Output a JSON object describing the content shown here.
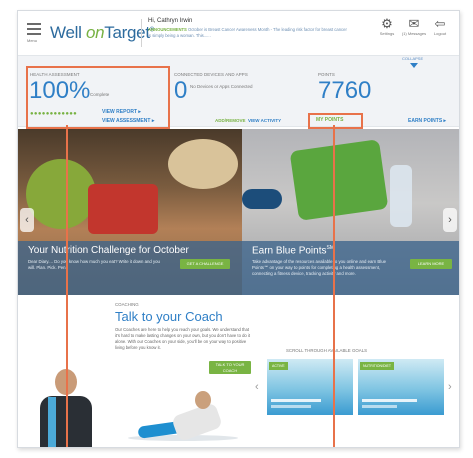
{
  "header": {
    "menu_label": "Menu",
    "logo_prefix": "Well ",
    "logo_on": "on",
    "logo_suffix": "Target",
    "logo_mark": "®",
    "greeting": "Hi, Cathryn Irwin",
    "announcement_label": "ANNOUNCEMENTS",
    "announcement_text": "October is Breast Cancer Awareness Month - The leading risk factor for breast cancer is simply being a woman. This......",
    "settings_label": "Settings",
    "messages_label": "(1) Messages",
    "logout_label": "Logout",
    "settings_icon": "gear-icon",
    "messages_icon": "envelope-icon",
    "logout_icon": "logout-icon"
  },
  "stats": {
    "collapse_label": "COLLAPSE",
    "health": {
      "label": "HEALTH ASSESSMENT",
      "percent": "100%",
      "status": "Complete",
      "view_report": "VIEW REPORT ▸",
      "view_assessment": "VIEW ASSESSMENT ▸",
      "progress_dots": "●●●●●●●●●●●●"
    },
    "devices": {
      "label": "CONNECTED DEVICES AND APPS",
      "count": "0",
      "note": "No Devices or Apps Connected"
    },
    "points": {
      "label": "POINTS",
      "value": "7760"
    },
    "links": {
      "add_remove": "ADD/REMOVE",
      "view_activity": "VIEW ACTIVITY",
      "my_points": "MY POINTS",
      "earn_points": "EARN POINTS ▸"
    }
  },
  "promos": [
    {
      "title": "Your Nutrition Challenge for October",
      "body": "Dear Diary.... Do you know how much you eat? Write it down and you will. Plan. Pick. Pen.",
      "button": "GET A CHALLENGE"
    },
    {
      "title": "Earn Blue Points",
      "title_sup": "SM",
      "body": "Take advantage of the resources available to you online and earn Blue Points℠ on your way to points for completing a health assessment, connecting a fitness device, tracking activity and more.",
      "button": "LEARN MORE"
    }
  ],
  "coaching": {
    "label": "COACHING",
    "title": "Talk to your Coach",
    "body": "Our Coaches are here to help you reach your goals. We understand that it's hard to make lasting changes on your own, but you don't have to do it alone. With our Coaches on your side, you'll be on your way to positive living before you know it.",
    "button": "TALK TO YOUR COACH"
  },
  "goals": {
    "label": "SCROLL THROUGH AVAILABLE GOALS",
    "cards": [
      {
        "tag": "ACTIVE"
      },
      {
        "tag": "NUTRITION/DIET"
      }
    ]
  },
  "colors": {
    "brand_blue": "#2f7fc6",
    "brand_green": "#78b243",
    "highlight": "#e8724a"
  }
}
